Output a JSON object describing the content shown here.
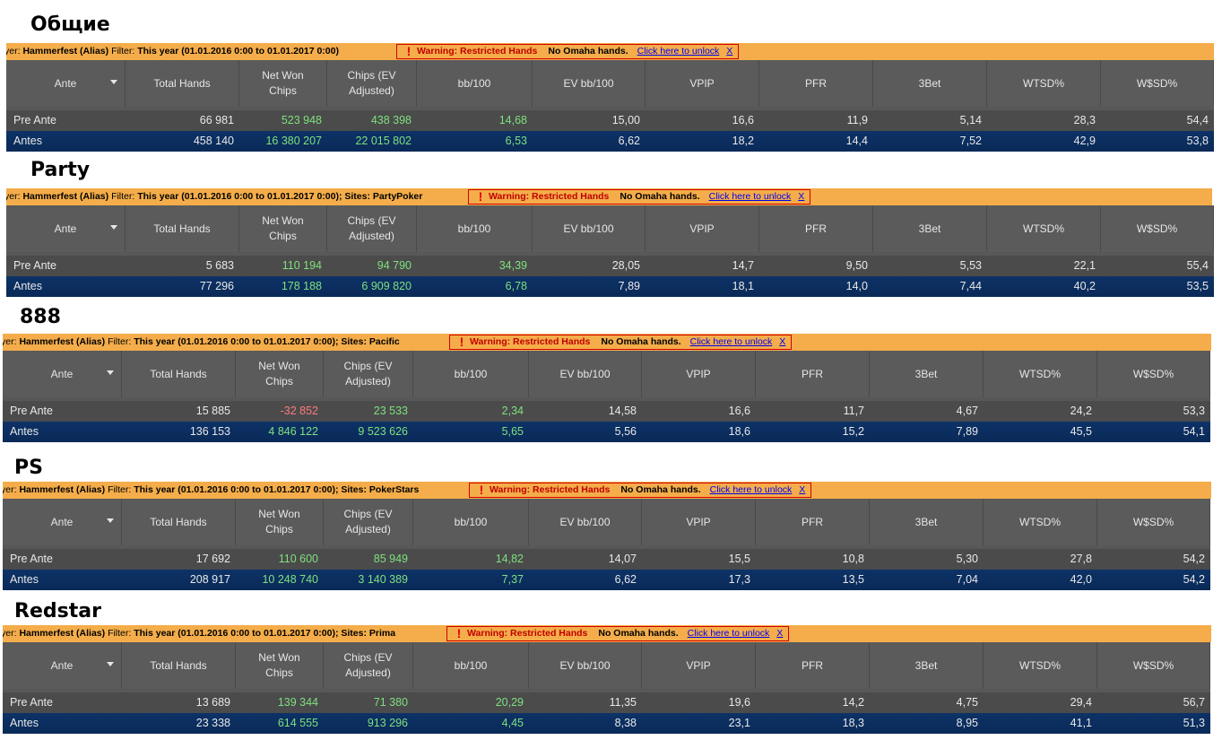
{
  "columns": [
    {
      "label": "Ante",
      "dropdown": true
    },
    {
      "label": "Total Hands"
    },
    {
      "label": "Net Won Chips"
    },
    {
      "label": "Chips (EV Adjusted)"
    },
    {
      "label": "bb/100"
    },
    {
      "label": "EV bb/100"
    },
    {
      "label": "VPIP"
    },
    {
      "label": "PFR"
    },
    {
      "label": "3Bet"
    },
    {
      "label": "WTSD%"
    },
    {
      "label": "W$SD%"
    }
  ],
  "warning": {
    "text": "Warning: Restricted Hands",
    "omaha": "No Omaha hands.",
    "unlock": "Click here to unlock",
    "close": "X"
  },
  "colors": {
    "positive": "#7ee07e",
    "negative": "#ff7b7b",
    "bar": "#f4ad4a",
    "header": "#5b5b5b",
    "row_alt": "#0d3266"
  },
  "sections": [
    {
      "title": "Общие",
      "player_prefix": "yer:",
      "player": "Hammerfest (Alias)",
      "filter_label": "Filter:",
      "filter": "This year (01.01.2016 0:00 to 01.01.2017 0:00)",
      "rows": [
        {
          "label": "Pre Ante",
          "values": [
            "66 981",
            "523 948",
            "438 398",
            "14,68",
            "15,00",
            "16,6",
            "11,9",
            "5,14",
            "28,3",
            "54,4"
          ]
        },
        {
          "label": "Antes",
          "values": [
            "458 140",
            "16 380 207",
            "22 015 802",
            "6,53",
            "6,62",
            "18,2",
            "14,4",
            "7,52",
            "42,9",
            "53,8"
          ]
        }
      ]
    },
    {
      "title": "Party",
      "player_prefix": "yer:",
      "player": "Hammerfest (Alias)",
      "filter_label": "Filter:",
      "filter": "This year (01.01.2016 0:00 to 01.01.2017 0:00); Sites: PartyPoker",
      "rows": [
        {
          "label": "Pre Ante",
          "values": [
            "5 683",
            "110 194",
            "94 790",
            "34,39",
            "28,05",
            "14,7",
            "9,50",
            "5,53",
            "22,1",
            "55,4"
          ]
        },
        {
          "label": "Antes",
          "values": [
            "77 296",
            "178 188",
            "6 909 820",
            "6,78",
            "7,89",
            "18,1",
            "14,0",
            "7,44",
            "40,2",
            "53,5"
          ]
        }
      ]
    },
    {
      "title": "888",
      "player_prefix": "yer:",
      "player": "Hammerfest (Alias)",
      "filter_label": "Filter:",
      "filter": "This year (01.01.2016 0:00 to 01.01.2017 0:00); Sites: Pacific",
      "rows": [
        {
          "label": "Pre Ante",
          "values": [
            "15 885",
            "-32 852",
            "23 533",
            "2,34",
            "14,58",
            "16,6",
            "11,7",
            "4,67",
            "24,2",
            "53,3"
          ]
        },
        {
          "label": "Antes",
          "values": [
            "136 153",
            "4 846 122",
            "9 523 626",
            "5,65",
            "5,56",
            "18,6",
            "15,2",
            "7,89",
            "45,5",
            "54,1"
          ]
        }
      ]
    },
    {
      "title": "PS",
      "player_prefix": "yer:",
      "player": "Hammerfest (Alias)",
      "filter_label": "Filter:",
      "filter": "This year (01.01.2016 0:00 to 01.01.2017 0:00); Sites: PokerStars",
      "rows": [
        {
          "label": "Pre Ante",
          "values": [
            "17 692",
            "110 600",
            "85 949",
            "14,82",
            "14,07",
            "15,5",
            "10,8",
            "5,30",
            "27,8",
            "54,2"
          ]
        },
        {
          "label": "Antes",
          "values": [
            "208 917",
            "10 248 740",
            "3 140 389",
            "7,37",
            "6,62",
            "17,3",
            "13,5",
            "7,04",
            "42,0",
            "54,2"
          ]
        }
      ]
    },
    {
      "title": "Redstar",
      "player_prefix": "yer:",
      "player": "Hammerfest (Alias)",
      "filter_label": "Filter:",
      "filter": "This year (01.01.2016 0:00 to 01.01.2017 0:00); Sites: Prima",
      "rows": [
        {
          "label": "Pre Ante",
          "values": [
            "13 689",
            "139 344",
            "71 380",
            "20,29",
            "11,35",
            "19,6",
            "14,2",
            "4,75",
            "29,4",
            "56,7"
          ]
        },
        {
          "label": "Antes",
          "values": [
            "23 338",
            "614 555",
            "913 296",
            "4,45",
            "8,38",
            "23,1",
            "18,3",
            "8,95",
            "41,1",
            "51,3"
          ]
        }
      ]
    }
  ]
}
